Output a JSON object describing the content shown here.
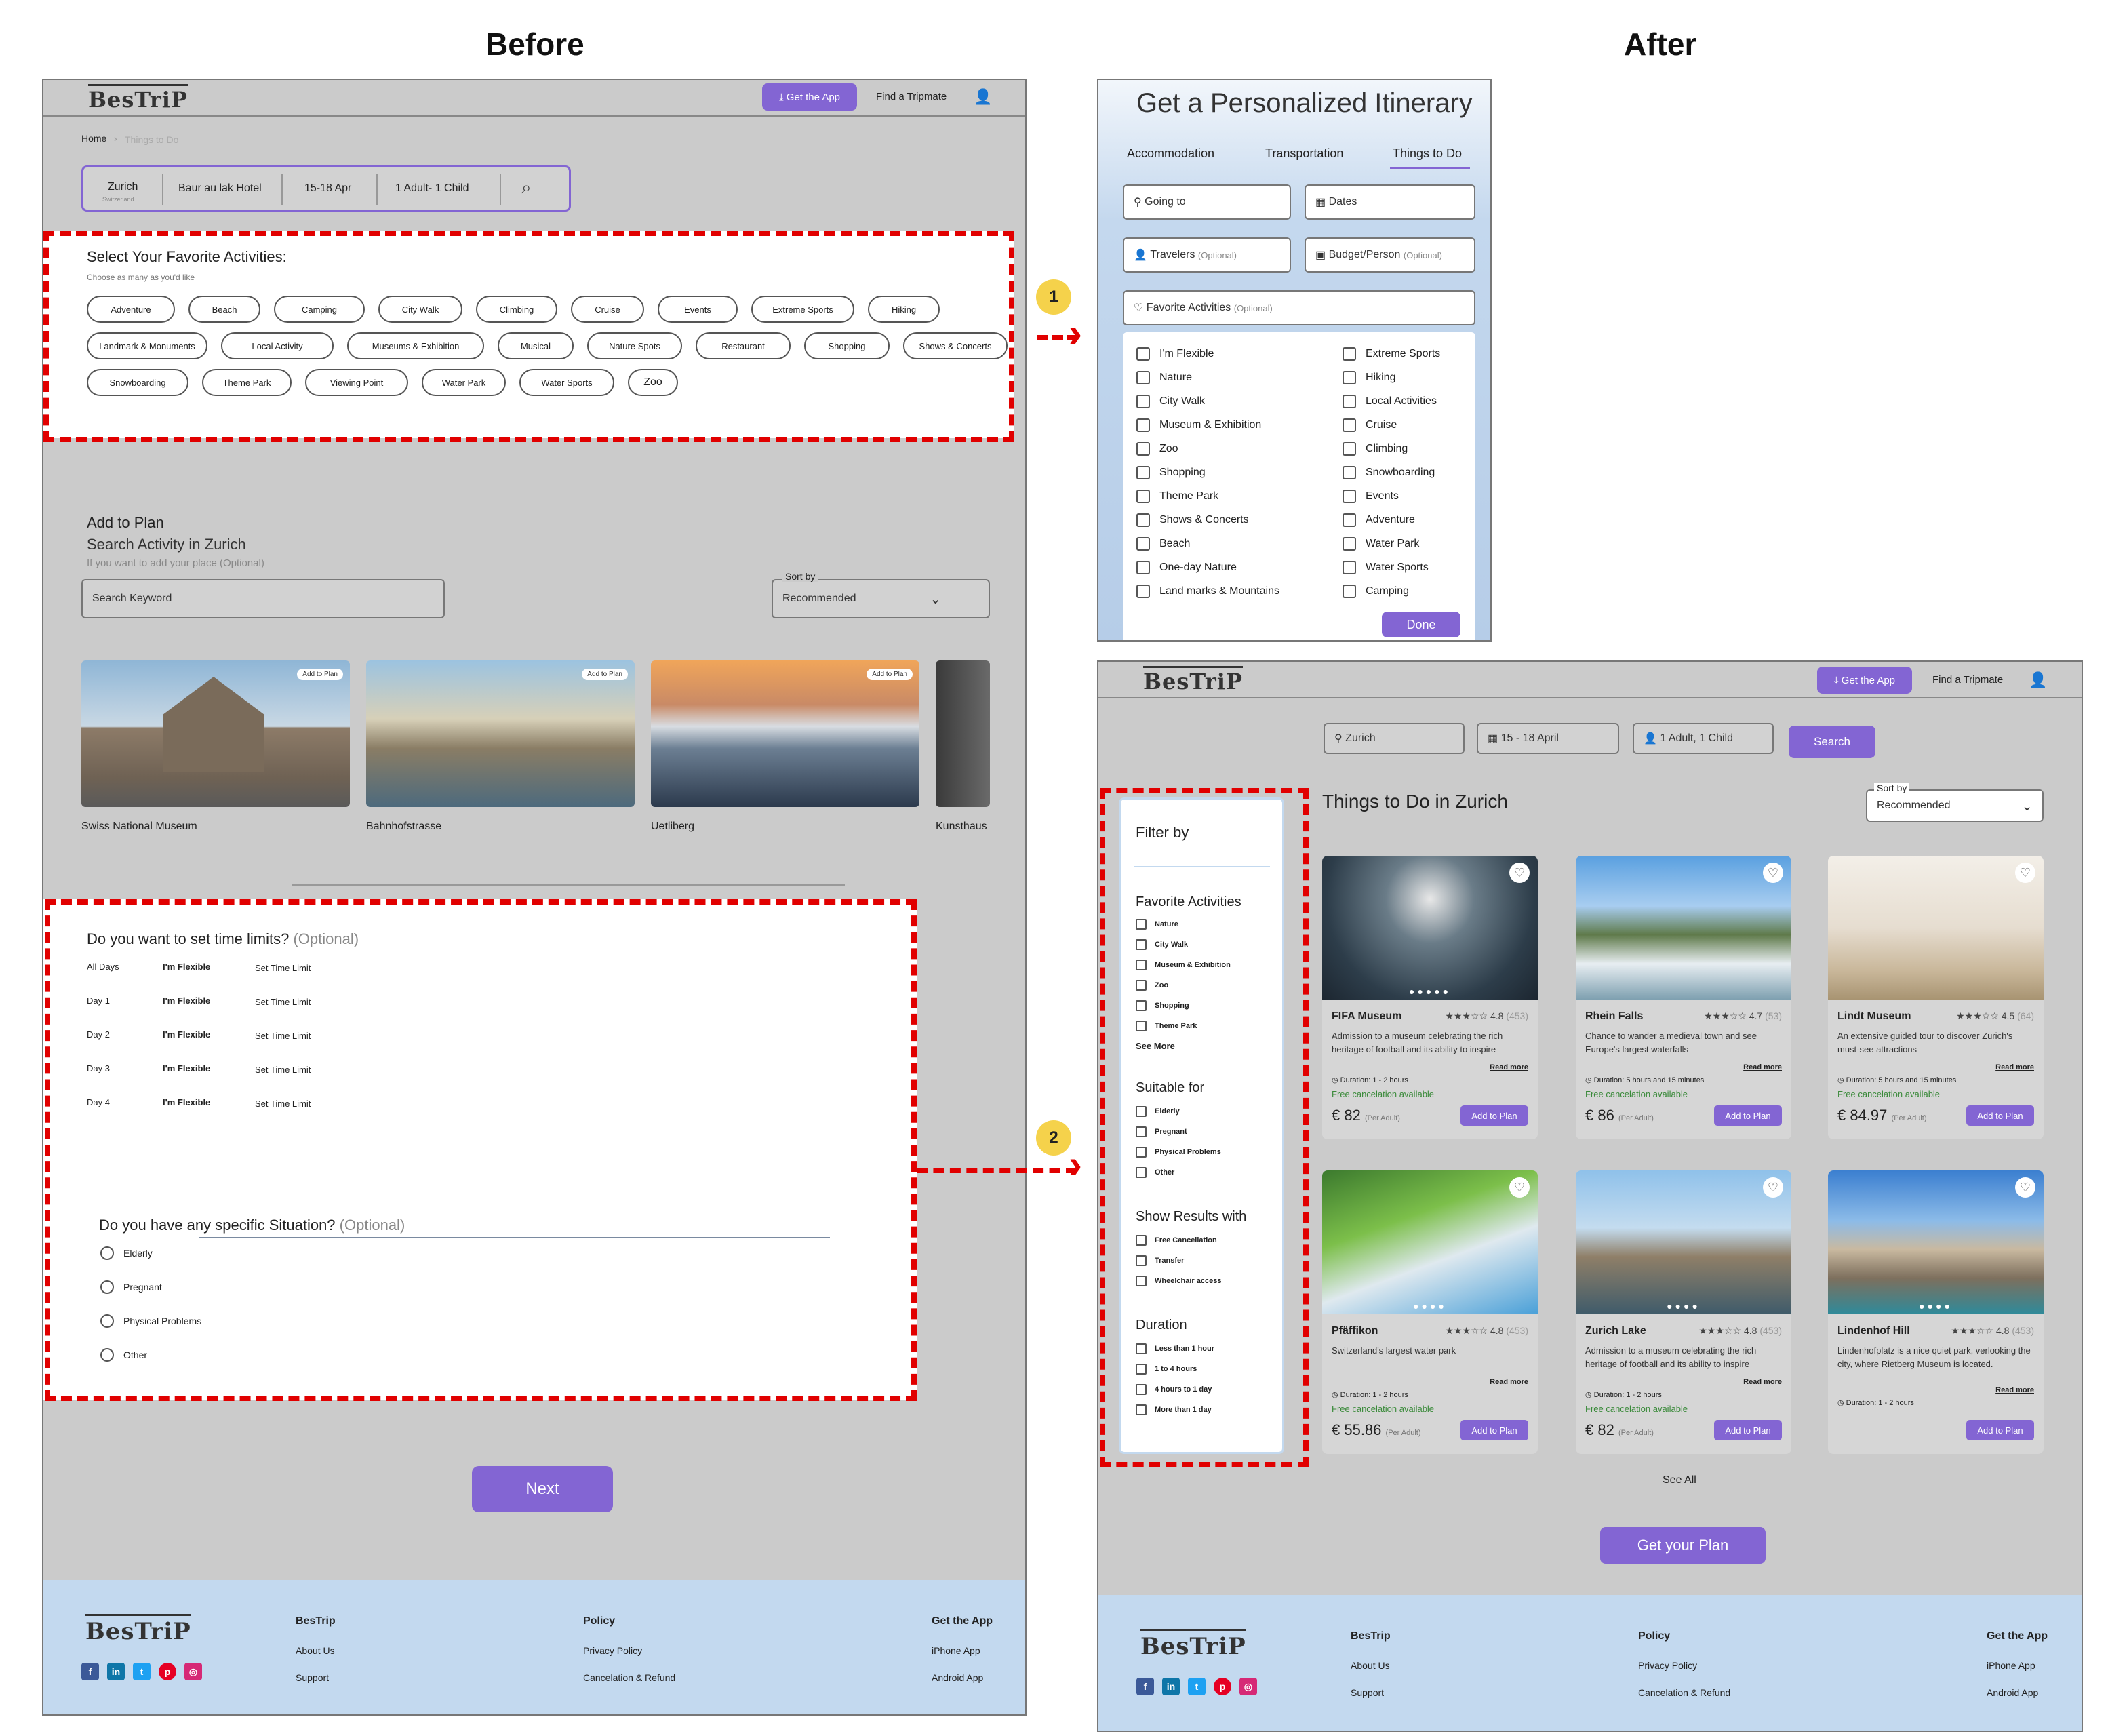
{
  "headings": {
    "before": "Before",
    "after": "After"
  },
  "callouts": {
    "one": "1",
    "two": "2"
  },
  "brand": {
    "logo": "BesTriP",
    "get_app": "Get the App",
    "find_tripmate": "Find a Tripmate"
  },
  "before": {
    "breadcrumb": {
      "home": "Home",
      "current": "Things to Do"
    },
    "search": {
      "city": "Zurich",
      "country": "Switzerland",
      "hotel": "Baur au lak Hotel",
      "dates": "15-18 Apr",
      "guests": "1 Adult- 1 Child"
    },
    "activities": {
      "title": "Select Your Favorite Activities:",
      "hint": "Choose as many as you'd like",
      "chips": [
        "Adventure",
        "Beach",
        "Camping",
        "City Walk",
        "Climbing",
        "Cruise",
        "Events",
        "Extreme Sports",
        "Hiking",
        "Landmark & Monuments",
        "Local Activity",
        "Museums & Exhibition",
        "Musical",
        "Nature Spots",
        "Restaurant",
        "Shopping",
        "Shows & Concerts",
        "Snowboarding",
        "Theme Park",
        "Viewing Point",
        "Water Park",
        "Water Sports",
        "Zoo"
      ]
    },
    "add_plan": {
      "title": "Add to Plan",
      "subtitle": "Search Activity in Zurich",
      "hint": "If you want to add your place (Optional)",
      "search_placeholder": "Search Keyword",
      "sort_label": "Sort by",
      "sort_value": "Recommended",
      "add_badge": "Add to Plan",
      "places": [
        "Swiss National Museum",
        "Bahnhofstrasse",
        "Uetliberg",
        "Kunsthaus"
      ]
    },
    "time": {
      "title": "Do you want to set time limits?",
      "optional": "(Optional)",
      "rows": [
        {
          "day": "All Days",
          "flex": "I'm Flexible",
          "set": "Set Time Limit"
        },
        {
          "day": "Day 1",
          "flex": "I'm Flexible",
          "set": "Set Time Limit"
        },
        {
          "day": "Day 2",
          "flex": "I'm Flexible",
          "set": "Set Time Limit"
        },
        {
          "day": "Day 3",
          "flex": "I'm Flexible",
          "set": "Set Time Limit"
        },
        {
          "day": "Day 4",
          "flex": "I'm Flexible",
          "set": "Set Time Limit"
        }
      ]
    },
    "situation": {
      "title": "Do you have any specific Situation?",
      "optional": "(Optional)",
      "options": [
        "Elderly",
        "Pregnant",
        "Physical Problems",
        "Other"
      ]
    },
    "next": "Next"
  },
  "itinerary": {
    "title": "Get a Personalized Itinerary",
    "tabs": [
      "Accommodation",
      "Transportation",
      "Things to Do"
    ],
    "going_to": "Going to",
    "dates": "Dates",
    "travelers": "Travelers",
    "budget": "Budget/Person",
    "optional": "(Optional)",
    "favorite": "Favorite Activities",
    "left_options": [
      "I'm Flexible",
      "Nature",
      "City Walk",
      "Museum & Exhibition",
      "Zoo",
      "Shopping",
      "Theme Park",
      "Shows & Concerts",
      "Beach",
      "One-day Nature",
      "Land marks & Mountains"
    ],
    "right_options": [
      "Extreme Sports",
      "Hiking",
      "Local Activities",
      "Cruise",
      "Climbing",
      "Snowboarding",
      "Events",
      "Adventure",
      "Water Park",
      "Water Sports",
      "Camping"
    ],
    "done": "Done"
  },
  "after": {
    "search": {
      "city": "Zurich",
      "dates": "15 - 18 April",
      "guests": "1 Adult, 1 Child",
      "button": "Search"
    },
    "page_title": "Things to Do in Zurich",
    "sort_label": "Sort by",
    "sort_value": "Recommended",
    "filter": {
      "title": "Filter by",
      "fav_title": "Favorite Activities",
      "fav": [
        "Nature",
        "City Walk",
        "Museum & Exhibition",
        "Zoo",
        "Shopping",
        "Theme Park"
      ],
      "see_more": "See More",
      "suit_title": "Suitable for",
      "suit": [
        "Elderly",
        "Pregnant",
        "Physical Problems",
        "Other"
      ],
      "show_title": "Show Results with",
      "show": [
        "Free Cancellation",
        "Transfer",
        "Wheelchair access"
      ],
      "dur_title": "Duration",
      "dur": [
        "Less than 1 hour",
        "1 to 4 hours",
        "4 hours to 1 day",
        "More than 1 day"
      ]
    },
    "cards": [
      {
        "title": "FIFA Museum",
        "rating": "★★★☆☆ 4.8",
        "reviews": "(453)",
        "desc": "Admission to a museum celebrating the rich heritage of football and its ability to inspire",
        "duration": "Duration: 1 - 2 hours",
        "free": "Free cancelation available",
        "price": "€ 82",
        "per": "(Per Adult)"
      },
      {
        "title": "Rhein Falls",
        "rating": "★★★☆☆ 4.7",
        "reviews": "(53)",
        "desc": "Chance to wander a medieval town and see Europe's largest waterfalls",
        "duration": "Duration: 5 hours and 15 minutes",
        "free": "Free cancelation available",
        "price": "€ 86",
        "per": "(Per Adult)"
      },
      {
        "title": "Lindt Museum",
        "rating": "★★★☆☆ 4.5",
        "reviews": "(64)",
        "desc": "An extensive guided tour to discover Zurich's must-see attractions",
        "duration": "Duration: 5 hours and 15 minutes",
        "free": "Free cancelation available",
        "price": "€ 84.97",
        "per": "(Per Adult)"
      },
      {
        "title": "Pfäffikon",
        "rating": "★★★☆☆ 4.8",
        "reviews": "(453)",
        "desc": "Switzerland's largest water park",
        "duration": "Duration: 1 - 2 hours",
        "free": "Free cancelation available",
        "price": "€ 55.86",
        "per": "(Per Adult)"
      },
      {
        "title": "Zurich Lake",
        "rating": "★★★☆☆ 4.8",
        "reviews": "(453)",
        "desc": "Admission to a museum celebrating the rich heritage of football and its ability to inspire",
        "duration": "Duration: 1 - 2 hours",
        "free": "Free cancelation available",
        "price": "€ 82",
        "per": "(Per Adult)"
      },
      {
        "title": "Lindenhof Hill",
        "rating": "★★★☆☆ 4.8",
        "reviews": "(453)",
        "desc": "Lindenhofplatz is a nice quiet park, verlooking the city, where Rietberg Museum is located.",
        "duration": "Duration: 1 - 2 hours",
        "free": "",
        "price": "",
        "per": ""
      }
    ],
    "read_more": "Read more",
    "add_to_plan": "Add to Plan",
    "see_all": "See All",
    "get_plan": "Get your Plan"
  },
  "footer": {
    "col1": {
      "title": "BesTrip",
      "links": [
        "About Us",
        "Support"
      ]
    },
    "col2": {
      "title": "Policy",
      "links": [
        "Privacy Policy",
        "Cancelation & Refund"
      ]
    },
    "col3": {
      "title": "Get the App",
      "links": [
        "iPhone App",
        "Android App"
      ]
    }
  },
  "colors": {
    "accent": "#8365d3",
    "dash": "#e10000",
    "footer": "#c3d9ef",
    "frame": "#cbcbcb",
    "callout": "#f5d24b"
  }
}
